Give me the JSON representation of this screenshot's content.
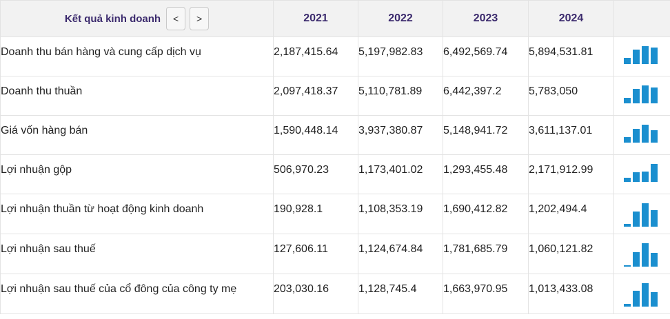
{
  "header": {
    "title": "Kết quả kinh doanh",
    "prev_label": "<",
    "next_label": ">",
    "years": [
      "2021",
      "2022",
      "2023",
      "2024"
    ]
  },
  "bar_color": "#1b8fcf",
  "rows": [
    {
      "label": "Doanh thu bán hàng và cung cấp dịch vụ",
      "values": [
        "2,187,415.64",
        "5,197,982.83",
        "6,492,569.74",
        "5,894,531.81"
      ],
      "nums": [
        2187415.64,
        5197982.83,
        6492569.74,
        5894531.81
      ]
    },
    {
      "label": "Doanh thu thuần",
      "values": [
        "2,097,418.37",
        "5,110,781.89",
        "6,442,397.2",
        "5,783,050"
      ],
      "nums": [
        2097418.37,
        5110781.89,
        6442397.2,
        5783050
      ]
    },
    {
      "label": "Giá vốn hàng bán",
      "values": [
        "1,590,448.14",
        "3,937,380.87",
        "5,148,941.72",
        "3,611,137.01"
      ],
      "nums": [
        1590448.14,
        3937380.87,
        5148941.72,
        3611137.01
      ]
    },
    {
      "label": "Lợi nhuận gộp",
      "values": [
        "506,970.23",
        "1,173,401.02",
        "1,293,455.48",
        "2,171,912.99"
      ],
      "nums": [
        506970.23,
        1173401.02,
        1293455.48,
        2171912.99
      ]
    },
    {
      "label": "Lợi nhuận thuần từ hoạt động kinh doanh",
      "values": [
        "190,928.1",
        "1,108,353.19",
        "1,690,412.82",
        "1,202,494.4"
      ],
      "nums": [
        190928.1,
        1108353.19,
        1690412.82,
        1202494.4
      ]
    },
    {
      "label": "Lợi nhuận sau thuế",
      "values": [
        "127,606.11",
        "1,124,674.84",
        "1,781,685.79",
        "1,060,121.82"
      ],
      "nums": [
        127606.11,
        1124674.84,
        1781685.79,
        1060121.82
      ]
    },
    {
      "label": "Lợi nhuận sau thuế của cổ đông của công ty mẹ",
      "values": [
        "203,030.16",
        "1,128,745.4",
        "1,663,970.95",
        "1,013,433.08"
      ],
      "nums": [
        203030.16,
        1128745.4,
        1663970.95,
        1013433.08
      ]
    }
  ]
}
